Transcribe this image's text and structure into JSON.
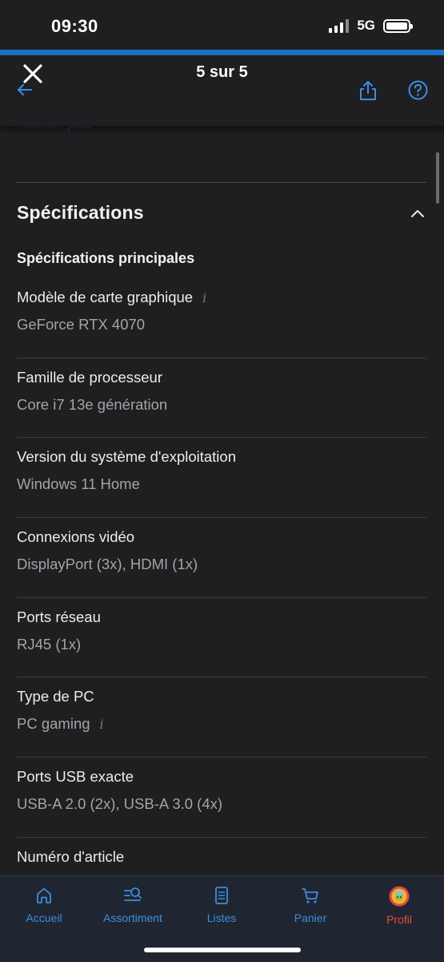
{
  "status_bar": {
    "time": "09:30",
    "network": "5G"
  },
  "header": {
    "title": "5 sur 5"
  },
  "content": {
    "peek_text": "Afficher plus",
    "section_title": "Spécifications",
    "subsection_title": "Spécifications principales",
    "specs": [
      {
        "label": "Modèle de carte graphique",
        "value": "GeForce RTX 4070",
        "label_info": true,
        "value_info": false
      },
      {
        "label": "Famille de processeur",
        "value": "Core i7 13e génération",
        "label_info": false,
        "value_info": false
      },
      {
        "label": "Version du système d'exploitation",
        "value": "Windows 11 Home",
        "label_info": false,
        "value_info": false
      },
      {
        "label": "Connexions vidéo",
        "value": "DisplayPort (3x), HDMI (1x)",
        "label_info": false,
        "value_info": false
      },
      {
        "label": "Ports réseau",
        "value": "RJ45 (1x)",
        "label_info": false,
        "value_info": false
      },
      {
        "label": "Type de PC",
        "value": "PC gaming",
        "label_info": false,
        "value_info": true
      },
      {
        "label": "Ports USB exacte",
        "value": "USB-A 2.0 (2x), USB-A 3.0 (4x)",
        "label_info": false,
        "value_info": false
      },
      {
        "label": "Numéro d'article",
        "value": "",
        "label_info": false,
        "value_info": false
      }
    ],
    "info_glyph": "i"
  },
  "tab_bar": {
    "tabs": [
      {
        "label": "Accueil",
        "icon": "home-icon"
      },
      {
        "label": "Assortiment",
        "icon": "search-list-icon"
      },
      {
        "label": "Listes",
        "icon": "list-icon"
      },
      {
        "label": "Panier",
        "icon": "cart-icon"
      },
      {
        "label": "Profil",
        "icon": "avatar-icon",
        "active": true
      }
    ]
  },
  "colors": {
    "accent": "#1a75cf",
    "tab_blue": "#3d8ce0",
    "active_tab": "#e24b3c",
    "background": "#1f1f21"
  }
}
